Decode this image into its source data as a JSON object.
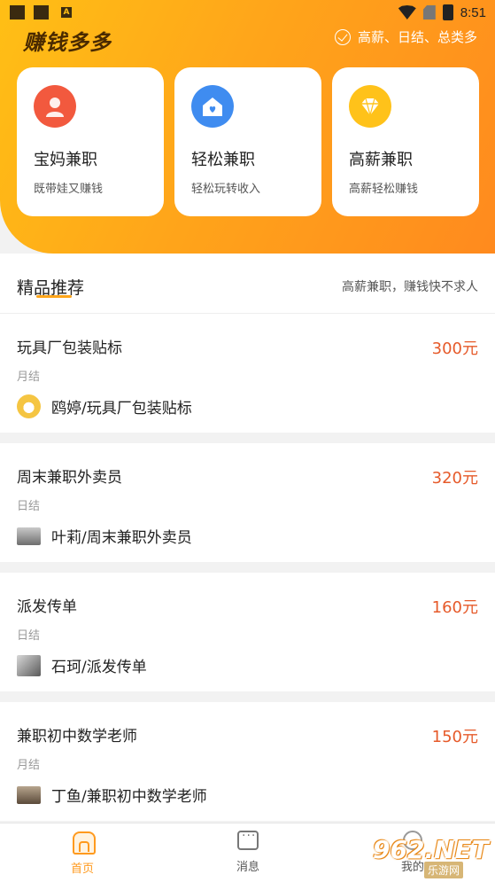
{
  "status_bar": {
    "time": "8:51"
  },
  "header": {
    "logo": "赚钱多多",
    "slogan": "高薪、日结、总类多"
  },
  "categories": [
    {
      "title": "宝妈兼职",
      "subtitle": "既带娃又赚钱",
      "icon": "mother-icon",
      "color": "#f2593e"
    },
    {
      "title": "轻松兼职",
      "subtitle": "轻松玩转收入",
      "icon": "home-heart-icon",
      "color": "#3f8cf0"
    },
    {
      "title": "高薪兼职",
      "subtitle": "高薪轻松赚钱",
      "icon": "diamond-icon",
      "color": "#ffc21a"
    }
  ],
  "section": {
    "title": "精品推荐",
    "subtitle": "高薪兼职，赚钱快不求人"
  },
  "jobs": [
    {
      "title": "玩具厂包装贴标",
      "pay": "300元",
      "settlement": "月结",
      "poster": "鸥婷/玩具厂包装贴标"
    },
    {
      "title": "周末兼职外卖员",
      "pay": "320元",
      "settlement": "日结",
      "poster": "叶莉/周末兼职外卖员"
    },
    {
      "title": "派发传单",
      "pay": "160元",
      "settlement": "日结",
      "poster": "石珂/派发传单"
    },
    {
      "title": "兼职初中数学老师",
      "pay": "150元",
      "settlement": "月结",
      "poster": "丁鱼/兼职初中数学老师"
    }
  ],
  "tabs": [
    {
      "label": "首页",
      "icon": "home-icon",
      "active": true
    },
    {
      "label": "消息",
      "icon": "message-icon",
      "active": false
    },
    {
      "label": "我的",
      "icon": "profile-icon",
      "active": false
    }
  ],
  "watermark": {
    "number": "962.NET",
    "text": "乐游网"
  },
  "colors": {
    "accent": "#ff9a1e",
    "pay": "#e65a2a",
    "hero_start": "#ffbf15",
    "hero_end": "#ff8a1e"
  }
}
